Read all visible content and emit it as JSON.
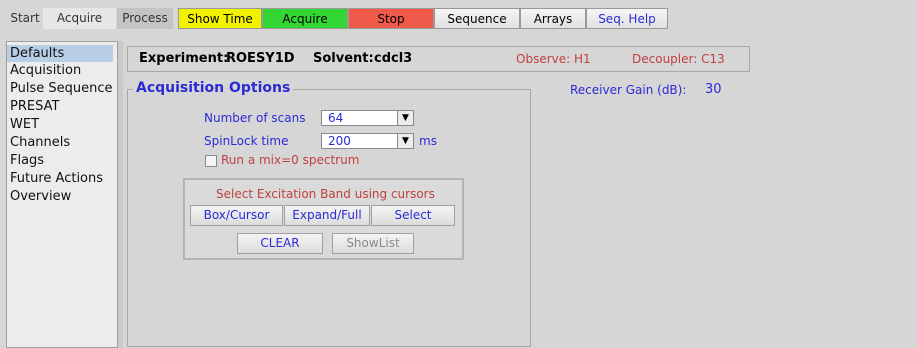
{
  "toolbar": {
    "tabs": [
      "Start",
      "Acquire",
      "Process"
    ],
    "buttons": [
      "Show Time",
      "Acquire",
      "Stop",
      "Sequence",
      "Arrays",
      "Seq. Help"
    ],
    "colors": {
      "show_time": "#f2f200",
      "acquire": "#33d633",
      "stop": "#f05a4a"
    }
  },
  "sidebar": {
    "items": [
      "Defaults",
      "Acquisition",
      "Pulse Sequence",
      "PRESAT",
      "WET",
      "Channels",
      "Flags",
      "Future Actions",
      "Overview"
    ],
    "selected": "Defaults"
  },
  "experiment": {
    "experiment_label": "Experiment:",
    "experiment_value": "ROESY1D",
    "solvent_label": "Solvent:",
    "solvent_value": "cdcl3",
    "observe": "Observe: H1",
    "decoupler": "Decoupler: C13"
  },
  "receiver": {
    "label": "Receiver Gain (dB):",
    "value": "30"
  },
  "acquisition": {
    "title": "Acquisition Options",
    "scans_label": "Number of scans",
    "scans_value": "64",
    "spinlock_label": "SpinLock time",
    "spinlock_value": "200",
    "spinlock_unit": "ms",
    "mix_label": "Run a mix=0 spectrum",
    "mix_checked": false
  },
  "excitation": {
    "title": "Select Excitation Band using cursors",
    "buttons": [
      "Box/Cursor",
      "Expand/Full",
      "Select",
      "CLEAR",
      "ShowList"
    ]
  }
}
